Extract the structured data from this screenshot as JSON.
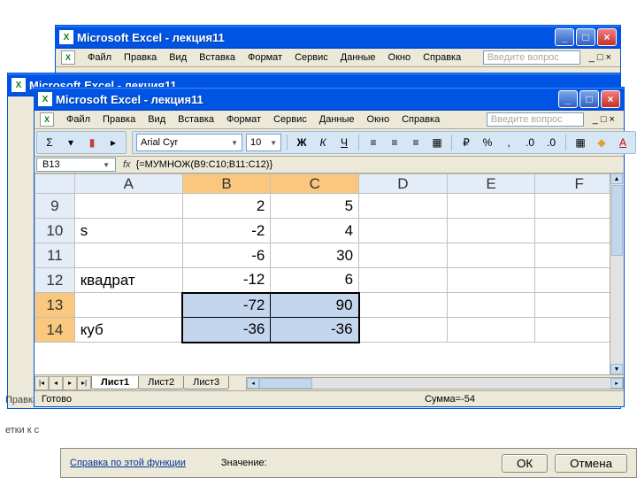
{
  "title": "Microsoft Excel - лекция11",
  "menus": [
    "Файл",
    "Правка",
    "Вид",
    "Вставка",
    "Формат",
    "Сервис",
    "Данные",
    "Окно",
    "Справка"
  ],
  "question_placeholder": "Введите вопрос",
  "toolbar": {
    "font_name": "Arial Cyr",
    "font_size": "10"
  },
  "name_box": "B13",
  "formula": "{=МУМНОЖ(B9:C10;B11:C12)}",
  "columns": [
    "A",
    "B",
    "C",
    "D",
    "E",
    "F"
  ],
  "rows": [
    {
      "n": "9",
      "sel": false,
      "cells": [
        "",
        "2",
        "5",
        "",
        "",
        ""
      ]
    },
    {
      "n": "10",
      "sel": false,
      "cells": [
        "s",
        "-2",
        "4",
        "",
        "",
        ""
      ]
    },
    {
      "n": "11",
      "sel": false,
      "cells": [
        "",
        "-6",
        "30",
        "",
        "",
        ""
      ]
    },
    {
      "n": "12",
      "sel": false,
      "cells": [
        "квадрат",
        "-12",
        "6",
        "",
        "",
        ""
      ]
    },
    {
      "n": "13",
      "sel": true,
      "cells": [
        "",
        "-72",
        "90",
        "",
        "",
        ""
      ]
    },
    {
      "n": "14",
      "sel": true,
      "cells": [
        "куб",
        "-36",
        "-36",
        "",
        "",
        ""
      ]
    }
  ],
  "tabs": [
    "Лист1",
    "Лист2",
    "Лист3"
  ],
  "status": {
    "ready": "Готово",
    "sum": "Сумма=-54"
  },
  "back": {
    "status": "Правка",
    "frag": "етки к с"
  },
  "front_back_title": "Microsoft Excel - лекция11",
  "dialog": {
    "help_link": "Справка по этой функции",
    "value_label": "Значение:",
    "ok": "ОК",
    "cancel": "Отмена"
  }
}
